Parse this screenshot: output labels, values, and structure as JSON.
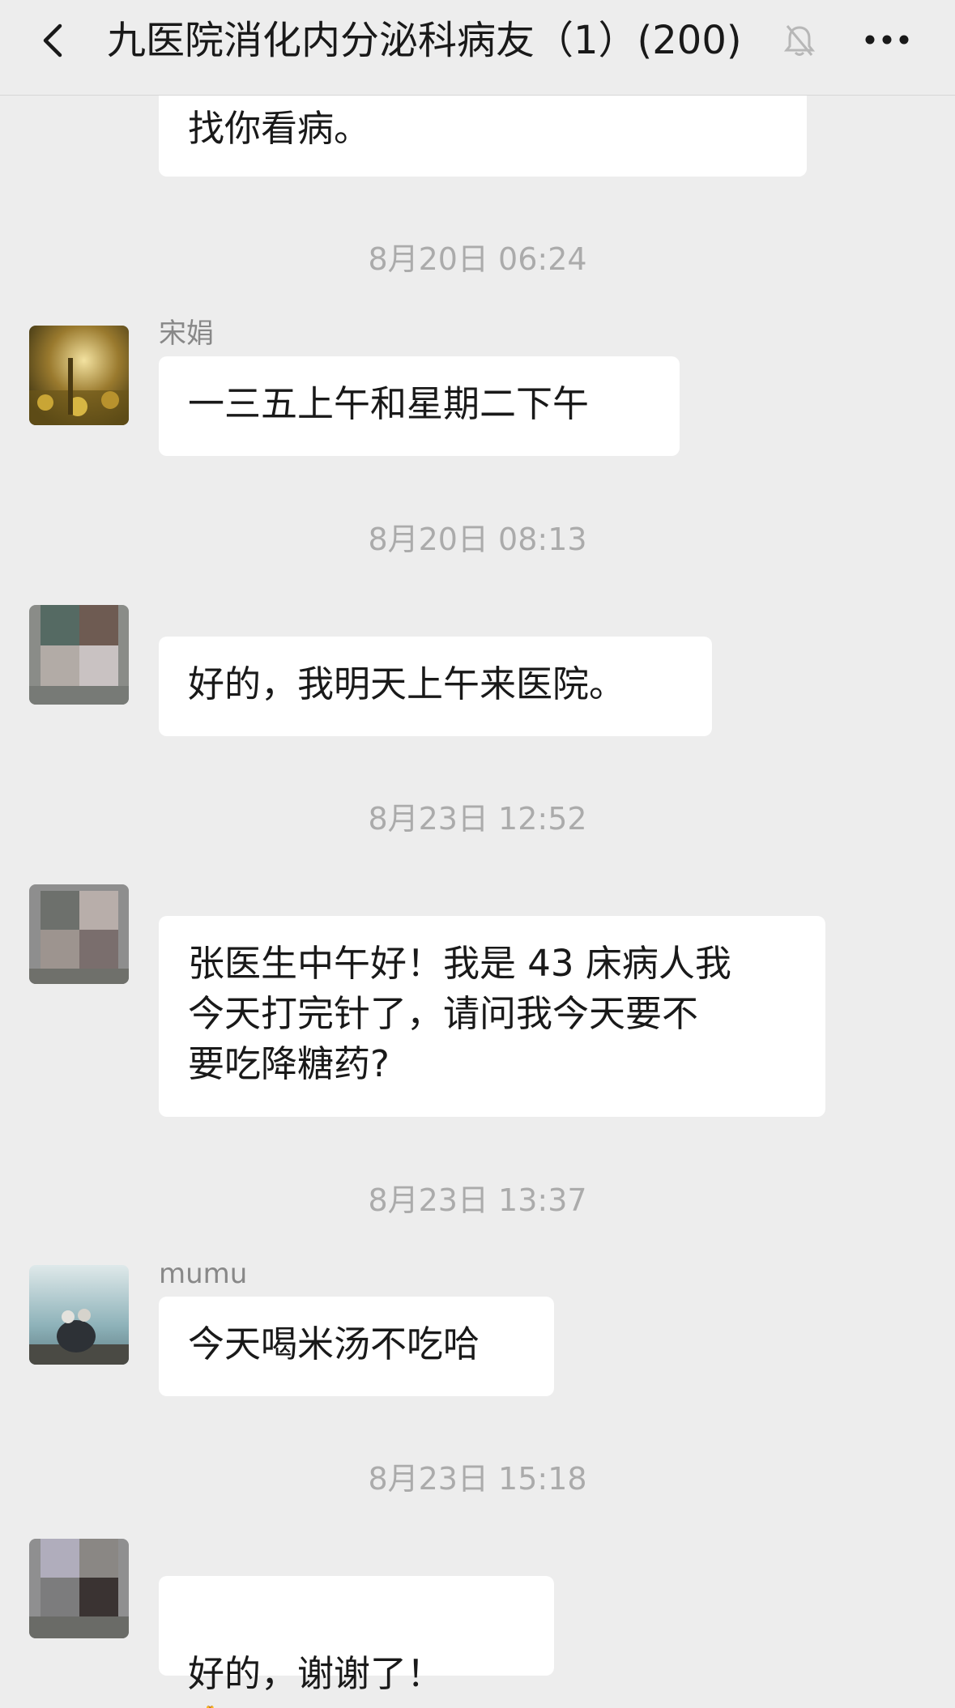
{
  "header": {
    "title": "九医院消化内分泌科病友（1）(200)",
    "back_icon": "chevron-left-icon",
    "mute_icon": "bell-off-icon",
    "more_icon": "more-dots-icon"
  },
  "messages": [
    {
      "text": "找你看病。"
    },
    {
      "time": "8月20日 06:24",
      "sender": "宋娟",
      "text": "一三五上午和星期二下午"
    },
    {
      "time": "8月20日 08:13",
      "sender": "",
      "text": "好的，我明天上午来医院。"
    },
    {
      "time": "8月23日 12:52",
      "sender": "",
      "text": "张医生中午好！我是 43 床病人我\n今天打完针了，请问我今天要不\n要吃降糖药?"
    },
    {
      "time": "8月23日 13:37",
      "sender": "mumu",
      "text": "今天喝米汤不吃哈"
    },
    {
      "time": "8月23日 15:18",
      "sender": "",
      "text": "好的，谢谢了！",
      "emoji": "🙏"
    }
  ],
  "colors": {
    "background": "#ededed",
    "bubble": "#ffffff",
    "timestamp": "#ababab",
    "sender": "#888888"
  }
}
